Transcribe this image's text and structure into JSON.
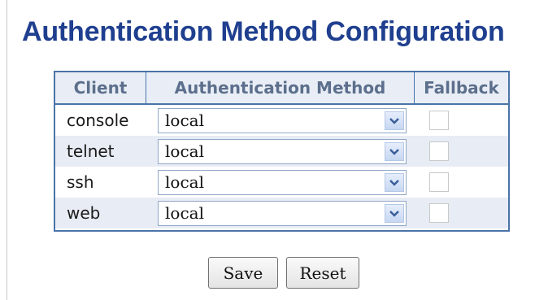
{
  "title": "Authentication Method Configuration",
  "table": {
    "headers": {
      "client": "Client",
      "method": "Authentication Method",
      "fallback": "Fallback"
    },
    "rows": [
      {
        "client": "console",
        "method": "local",
        "fallback": false
      },
      {
        "client": "telnet",
        "method": "local",
        "fallback": false
      },
      {
        "client": "ssh",
        "method": "local",
        "fallback": false
      },
      {
        "client": "web",
        "method": "local",
        "fallback": false
      }
    ]
  },
  "buttons": {
    "save": "Save",
    "reset": "Reset"
  },
  "colors": {
    "title": "#1f3f8f",
    "table_border": "#4a73a8",
    "header_bg": "#e9eef6",
    "alt_row_bg": "#e8ecf4"
  },
  "icons": {
    "dropdown": "chevron-down-icon"
  }
}
